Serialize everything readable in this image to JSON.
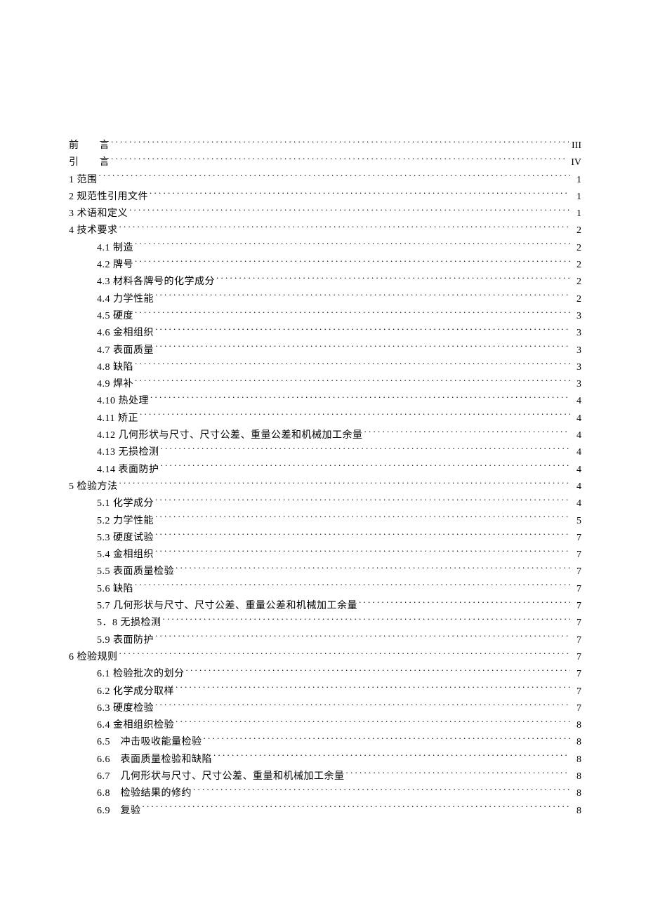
{
  "toc": [
    {
      "level": 0,
      "label": "前　　言",
      "page": "III"
    },
    {
      "level": 0,
      "label": "引　　言",
      "page": "IV"
    },
    {
      "level": 0,
      "label": "1 范围",
      "page": "1"
    },
    {
      "level": 0,
      "label": "2 规范性引用文件",
      "page": "1"
    },
    {
      "level": 0,
      "label": "3 术语和定义",
      "page": "1"
    },
    {
      "level": 0,
      "label": "4 技术要求",
      "page": "2"
    },
    {
      "level": 1,
      "label": "4.1 制造",
      "page": "2"
    },
    {
      "level": 1,
      "label": "4.2 牌号",
      "page": "2"
    },
    {
      "level": 1,
      "label": "4.3 材料各牌号的化学成分",
      "page": "2"
    },
    {
      "level": 1,
      "label": "4.4 力学性能",
      "page": "2"
    },
    {
      "level": 1,
      "label": "4.5 硬度",
      "page": "3"
    },
    {
      "level": 1,
      "label": "4.6 金相组织",
      "page": "3"
    },
    {
      "level": 1,
      "label": "4.7 表面质量",
      "page": "3"
    },
    {
      "level": 1,
      "label": "4.8 缺陷",
      "page": "3"
    },
    {
      "level": 1,
      "label": "4.9 焊补",
      "page": "3"
    },
    {
      "level": 1,
      "label": "4.10 热处理",
      "page": "4"
    },
    {
      "level": 1,
      "label": "4.11 矫正",
      "page": "4"
    },
    {
      "level": 1,
      "label": "4.12 几何形状与尺寸、尺寸公差、重量公差和机械加工余量",
      "page": "4"
    },
    {
      "level": 1,
      "label": "4.13 无损检测",
      "page": "4"
    },
    {
      "level": 1,
      "label": "4.14 表面防护",
      "page": "4"
    },
    {
      "level": 0,
      "label": "5 检验方法",
      "page": "4"
    },
    {
      "level": 1,
      "label": "5.1 化学成分",
      "page": "4"
    },
    {
      "level": 1,
      "label": "5.2 力学性能",
      "page": "5"
    },
    {
      "level": 1,
      "label": "5.3 硬度试验",
      "page": "7"
    },
    {
      "level": 1,
      "label": "5.4 金相组织",
      "page": "7"
    },
    {
      "level": 1,
      "label": "5.5 表面质量检验",
      "page": "7"
    },
    {
      "level": 1,
      "label": "5.6 缺陷",
      "page": "7"
    },
    {
      "level": 1,
      "label": "5.7 几何形状与尺寸、尺寸公差、重量公差和机械加工余量",
      "page": "7"
    },
    {
      "level": 1,
      "label": "5．8 无损检测",
      "page": "7"
    },
    {
      "level": 1,
      "label": "5.9 表面防护",
      "page": "7"
    },
    {
      "level": 0,
      "label": "6 检验规则",
      "page": "7"
    },
    {
      "level": 1,
      "label": "6.1 检验批次的划分",
      "page": "7"
    },
    {
      "level": 1,
      "label": "6.2 化学成分取样",
      "page": "7"
    },
    {
      "level": 1,
      "label": "6.3 硬度检验",
      "page": "7"
    },
    {
      "level": 1,
      "label": "6.4 金相组织检验",
      "page": "8"
    },
    {
      "level": 1,
      "label": "6.5　冲击吸收能量检验",
      "page": "8"
    },
    {
      "level": 1,
      "label": "6.6　表面质量检验和缺陷",
      "page": "8"
    },
    {
      "level": 1,
      "label": "6.7　几何形状与尺寸、尺寸公差、重量和机械加工余量",
      "page": "8"
    },
    {
      "level": 1,
      "label": "6.8　检验结果的修约",
      "page": "8"
    },
    {
      "level": 1,
      "label": "6.9　复验",
      "page": "8"
    }
  ]
}
